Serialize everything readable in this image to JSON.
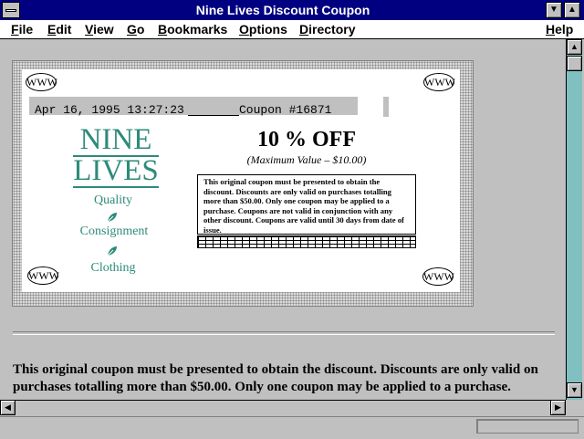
{
  "window": {
    "title": "Nine Lives Discount Coupon"
  },
  "menu": [
    "File",
    "Edit",
    "View",
    "Go",
    "Bookmarks",
    "Options",
    "Directory",
    "Help"
  ],
  "coupon": {
    "date": "Apr 16, 1995 13:27:23",
    "number": "Coupon #16871",
    "logo_line1": "NINE",
    "logo_line2": "LIVES",
    "tag_quality": "Quality",
    "tag_consignment": "Consignment",
    "tag_clothing": "Clothing",
    "offer": "10 % OFF",
    "max_value": "(Maximum Value – $10.00)",
    "fine_print": "This original coupon must be presented to obtain the discount. Discounts are only valid on purchases totalling more than $50.00. Only one coupon may be applied to a purchase. Coupons are not valid in conjunction with any other discount. Coupons are valid until 30 days from date of issue.",
    "corner_label": "WWW"
  },
  "body_text": "This original coupon must be presented to obtain the discount. Discounts are only valid on purchases totalling more than $50.00. Only one coupon may be applied to a purchase.",
  "icons": {
    "system_menu": "system-menu-icon",
    "minimize": "minimize-icon",
    "maximize": "maximize-icon",
    "leaf": "leaf-icon"
  },
  "colors": {
    "titlebar": "#000080",
    "logo": "#2e8b7a",
    "scroll_track": "#80c0c0"
  }
}
